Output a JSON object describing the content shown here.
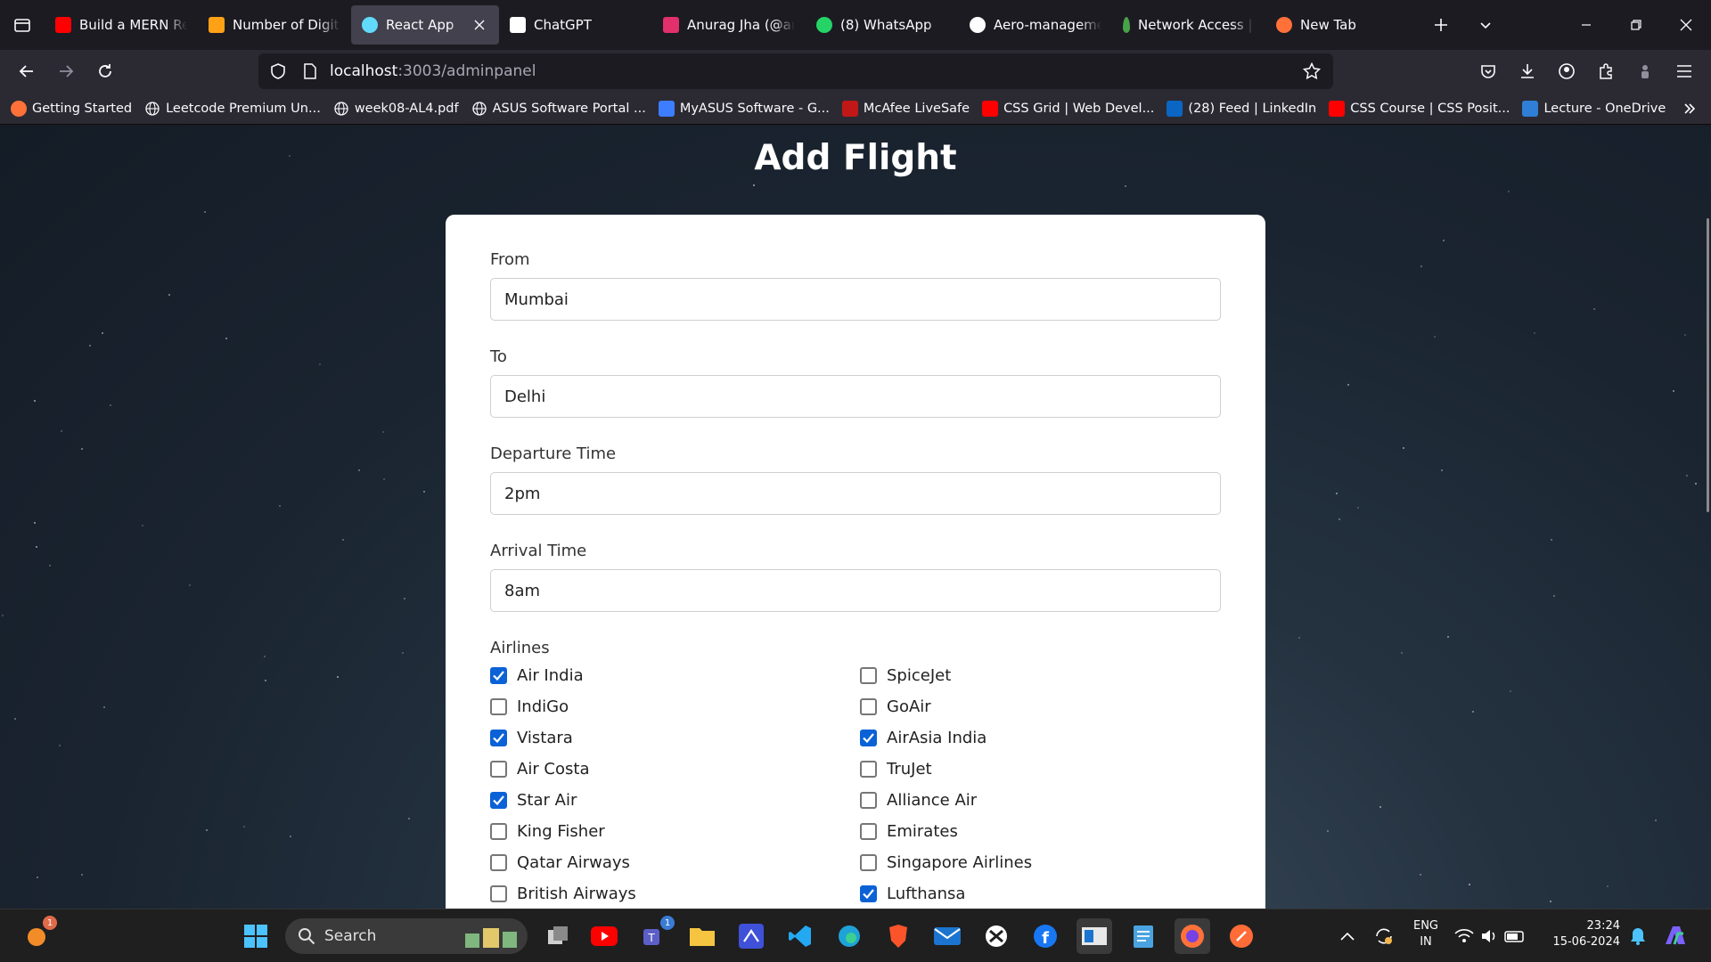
{
  "browser": {
    "tabs": [
      {
        "label": "Build a MERN Rea",
        "icon": "youtube-icon",
        "color": "#ff0000"
      },
      {
        "label": "Number of Digit (",
        "icon": "code-icon",
        "color": "#ffa116"
      },
      {
        "label": "React App",
        "icon": "react-icon",
        "color": "#61dafb",
        "active": true
      },
      {
        "label": "ChatGPT",
        "icon": "chatgpt-icon",
        "color": "#ffffff"
      },
      {
        "label": "Anurag Jha (@anu",
        "icon": "instagram-icon",
        "color": "#e1306c"
      },
      {
        "label": "(8) WhatsApp",
        "icon": "whatsapp-icon",
        "color": "#25d366"
      },
      {
        "label": "Aero-manageme",
        "icon": "github-icon",
        "color": "#ffffff"
      },
      {
        "label": "Network Access |",
        "icon": "mongodb-icon",
        "color": "#47a248"
      },
      {
        "label": "New Tab",
        "icon": "firefox-icon",
        "color": "#ff7139"
      }
    ],
    "url_host": "localhost",
    "url_path": ":3003/adminpanel",
    "bookmarks": [
      {
        "label": "Getting Started",
        "icon": "firefox-icon",
        "color": "#ff7139"
      },
      {
        "label": "Leetcode Premium Un...",
        "icon": "globe-icon",
        "color": "#cccccc"
      },
      {
        "label": "week08-AL4.pdf",
        "icon": "globe-icon",
        "color": "#cccccc"
      },
      {
        "label": "ASUS Software Portal ...",
        "icon": "globe-icon",
        "color": "#cccccc"
      },
      {
        "label": "MyASUS Software - G...",
        "icon": "asus-icon",
        "color": "#3d7dff"
      },
      {
        "label": "McAfee LiveSafe",
        "icon": "mcafee-icon",
        "color": "#c01818"
      },
      {
        "label": "CSS Grid | Web Devel...",
        "icon": "youtube-icon",
        "color": "#ff0000"
      },
      {
        "label": "(28) Feed | LinkedIn",
        "icon": "linkedin-icon",
        "color": "#0a66c2"
      },
      {
        "label": "CSS Course | CSS Posit...",
        "icon": "youtube-icon",
        "color": "#ff0000"
      },
      {
        "label": "Lecture - OneDrive",
        "icon": "onedrive-icon",
        "color": "#2f7fd6"
      }
    ]
  },
  "page": {
    "title": "Add Flight",
    "form": {
      "from_label": "From",
      "from_value": "Mumbai",
      "to_label": "To",
      "to_value": "Delhi",
      "departure_label": "Departure Time",
      "departure_value": "2pm",
      "arrival_label": "Arrival Time",
      "arrival_value": "8am",
      "airlines_label": "Airlines",
      "airlines": [
        {
          "name": "Air India",
          "checked": true
        },
        {
          "name": "SpiceJet",
          "checked": false
        },
        {
          "name": "IndiGo",
          "checked": false
        },
        {
          "name": "GoAir",
          "checked": false
        },
        {
          "name": "Vistara",
          "checked": true
        },
        {
          "name": "AirAsia India",
          "checked": true
        },
        {
          "name": "Air Costa",
          "checked": false
        },
        {
          "name": "TruJet",
          "checked": false
        },
        {
          "name": "Star Air",
          "checked": true
        },
        {
          "name": "Alliance Air",
          "checked": false
        },
        {
          "name": "King Fisher",
          "checked": false
        },
        {
          "name": "Emirates",
          "checked": false
        },
        {
          "name": "Qatar Airways",
          "checked": false
        },
        {
          "name": "Singapore Airlines",
          "checked": false
        },
        {
          "name": "British Airways",
          "checked": false
        },
        {
          "name": "Lufthansa",
          "checked": true
        }
      ]
    }
  },
  "taskbar": {
    "search_placeholder": "Search",
    "lang_top": "ENG",
    "lang_bottom": "IN",
    "time": "23:24",
    "date": "15-06-2024",
    "notification_count": "1",
    "teams_badge": "1"
  },
  "colors": {
    "checkbox_accent": "#0b62d6",
    "active_tab": "#42414d"
  }
}
